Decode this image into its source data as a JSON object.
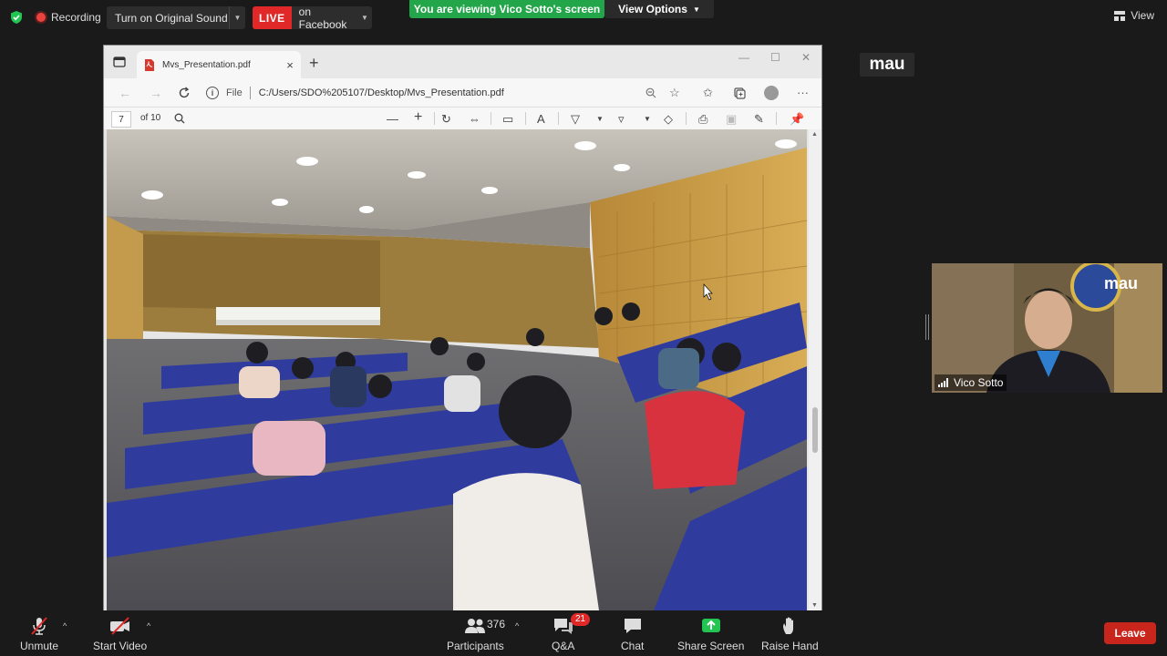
{
  "topbar": {
    "recording_label": "Recording",
    "original_sound_label": "Turn on Original Sound",
    "live_badge": "LIVE",
    "live_destination": "on Facebook",
    "viewing_banner": "You are viewing Vico Sotto's screen",
    "view_options_label": "View Options",
    "view_label": "View"
  },
  "browser": {
    "tab_title": "Mvs_Presentation.pdf",
    "url_scheme_label": "File",
    "url": "C:/Users/SDO%205107/Desktop/Mvs_Presentation.pdf"
  },
  "pdf_toolbar": {
    "current_page": "7",
    "page_total_label": "of 10"
  },
  "right_panel": {
    "mau_label": "mau",
    "tile_logo_text": "mau",
    "participant_name": "Vico Sotto"
  },
  "bottom_toolbar": {
    "unmute_label": "Unmute",
    "start_video_label": "Start Video",
    "participants_label": "Participants",
    "participants_count": "376",
    "qa_label": "Q&A",
    "qa_badge": "21",
    "chat_label": "Chat",
    "share_screen_label": "Share Screen",
    "raise_hand_label": "Raise Hand",
    "leave_label": "Leave"
  },
  "colors": {
    "live_red": "#e02828",
    "banner_green": "#23a54a",
    "share_green": "#23c552",
    "leave_red": "#c8251d"
  }
}
